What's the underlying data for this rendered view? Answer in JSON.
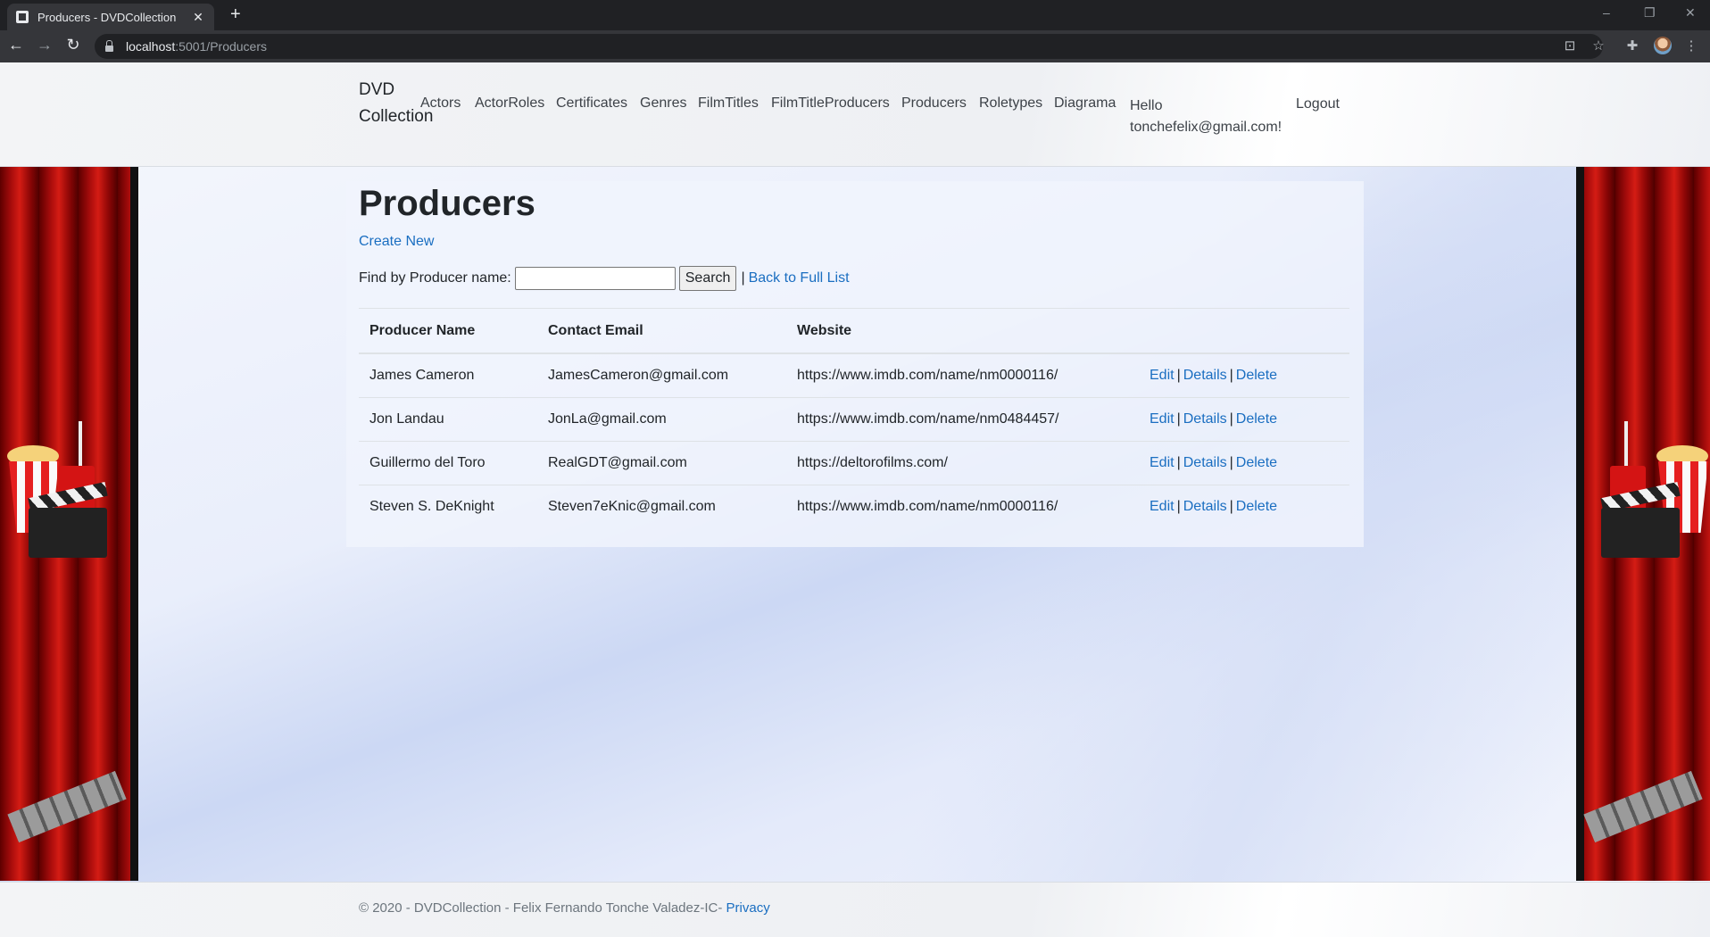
{
  "browser": {
    "tab_title": "Producers - DVDCollection",
    "new_tab": "+",
    "url_host": "localhost",
    "url_path": ":5001/Producers",
    "close_tab": "✕",
    "window_controls": [
      "–",
      "❐",
      "✕"
    ],
    "back": "←",
    "forward": "→",
    "reload": "↻",
    "translate": "⊡",
    "star": "☆",
    "extensions": "✚",
    "menu": "⋮"
  },
  "header": {
    "brand": "DVD Collection",
    "nav": [
      "Actors",
      "ActorRoles",
      "Certificates",
      "Genres",
      "FilmTitles",
      "FilmTitleProducers",
      "Producers",
      "Roletypes",
      "Diagrama"
    ],
    "hello_line1": "Hello",
    "hello_line2": "tonchefelix@gmail.com!",
    "logout": "Logout"
  },
  "main": {
    "title": "Producers",
    "create_new": "Create New",
    "find_label": "Find by Producer name:",
    "find_value": "",
    "search_button": "Search",
    "separator": "|",
    "back_link": "Back to Full List",
    "columns": [
      "Producer Name",
      "Contact Email",
      "Website"
    ],
    "rows": [
      {
        "name": "James Cameron",
        "email": "JamesCameron@gmail.com",
        "website": "https://www.imdb.com/name/nm0000116/"
      },
      {
        "name": "Jon Landau",
        "email": "JonLa@gmail.com",
        "website": "https://www.imdb.com/name/nm0484457/"
      },
      {
        "name": "Guillermo del Toro",
        "email": "RealGDT@gmail.com",
        "website": "https://deltorofilms.com/"
      },
      {
        "name": "Steven S. DeKnight",
        "email": "Steven7eKnic@gmail.com",
        "website": "https://www.imdb.com/name/nm0000116/"
      }
    ],
    "actions": {
      "edit": "Edit",
      "details": "Details",
      "delete": "Delete",
      "pipe": "|"
    }
  },
  "footer": {
    "text": "© 2020 - DVDCollection - Felix Fernando Tonche Valadez-IC-",
    "privacy": "Privacy"
  },
  "colors": {
    "link": "#1a6ec1",
    "curtain": "#c4140f",
    "chrome_dark": "#202124"
  }
}
